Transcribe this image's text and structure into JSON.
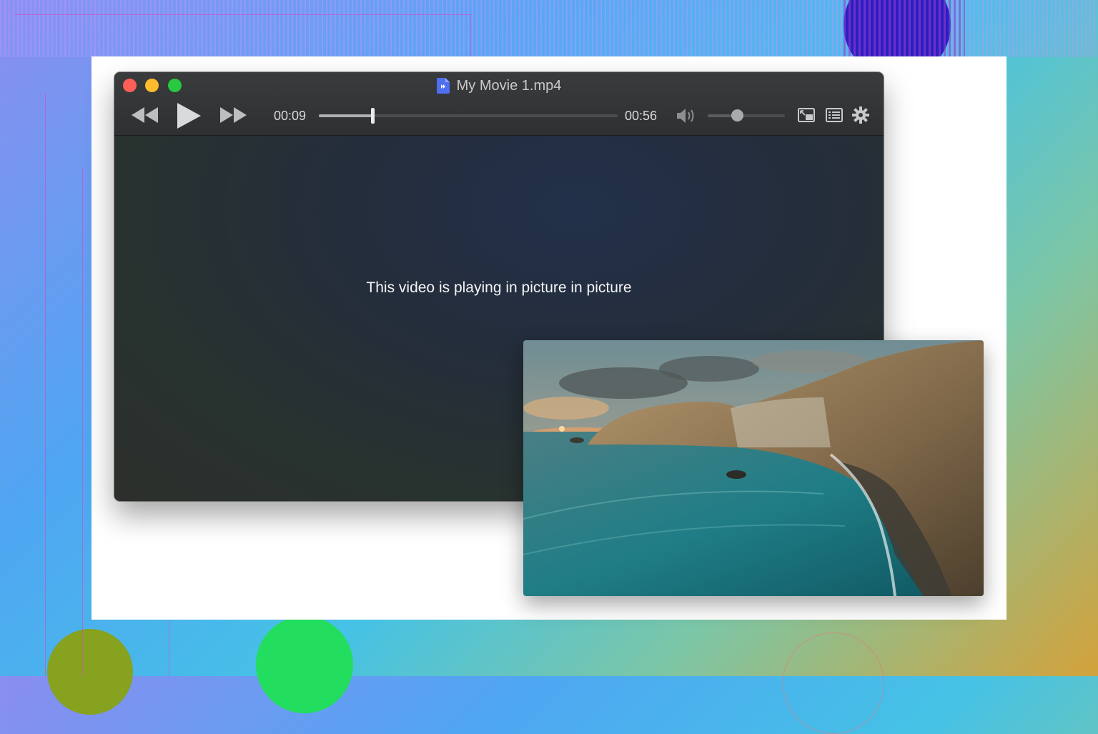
{
  "window": {
    "title": "My Movie 1.mp4"
  },
  "playback": {
    "current_time": "00:09",
    "duration": "00:56",
    "progress": 0.18,
    "volume": 0.38
  },
  "video": {
    "pip_message": "This video is playing in picture in picture"
  },
  "icons": {
    "close": "close-dot",
    "minimize": "minimize-dot",
    "maximize": "maximize-dot",
    "file": "video-file-icon",
    "rewind": "rewind-icon",
    "play": "play-icon",
    "forward": "fast-forward-icon",
    "volume": "speaker-icon",
    "pip": "picture-in-picture-icon",
    "playlist": "playlist-icon",
    "settings": "gear-icon"
  },
  "colors": {
    "close": "#fd5f57",
    "minimize": "#febc2e",
    "maximize": "#28c840",
    "file_icon": "#4f6ef0"
  }
}
